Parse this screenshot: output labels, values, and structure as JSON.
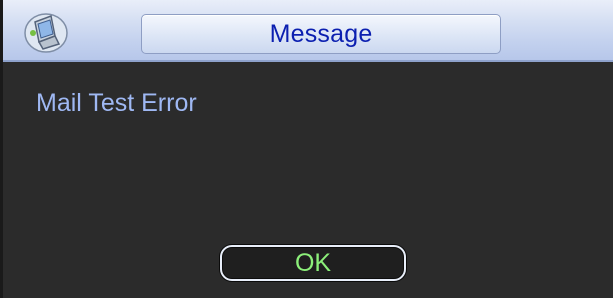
{
  "dialog": {
    "title": "Message",
    "message": "Mail Test Error",
    "ok_label": "OK",
    "icon": "computer-icon"
  },
  "colors": {
    "title_text": "#0b1fb0",
    "message_text": "#9fb8f3",
    "ok_text": "#8cf07a",
    "background": "#2b2b2b"
  }
}
